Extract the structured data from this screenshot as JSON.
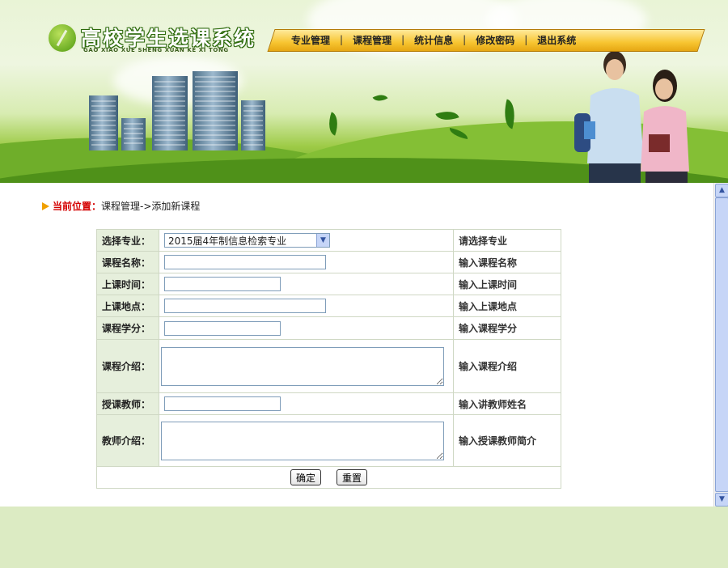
{
  "header": {
    "title": "高校学生选课系统",
    "subtitle": "GAO XIAO XUE SHENG XUAN KE XI TONG",
    "nav": [
      {
        "label": "专业管理"
      },
      {
        "label": "课程管理"
      },
      {
        "label": "统计信息"
      },
      {
        "label": "修改密码"
      },
      {
        "label": "退出系统"
      }
    ],
    "separator": "|"
  },
  "breadcrumb": {
    "label": "当前位置：",
    "path": "课程管理->添加新课程"
  },
  "form": {
    "major": {
      "label": "选择专业：",
      "value": "2015届4年制信息检索专业",
      "hint": "请选择专业"
    },
    "course_name": {
      "label": "课程名称：",
      "hint": "输入课程名称"
    },
    "class_time": {
      "label": "上课时间：",
      "hint": "输入上课时间"
    },
    "class_place": {
      "label": "上课地点：",
      "hint": "输入上课地点"
    },
    "credit": {
      "label": "课程学分：",
      "hint": "输入课程学分"
    },
    "intro": {
      "label": "课程介绍：",
      "hint": "输入课程介绍"
    },
    "teacher": {
      "label": "授课教师：",
      "hint": "输入讲教师姓名"
    },
    "teacher_intro": {
      "label": "教师介绍：",
      "hint": "输入授课教师简介"
    },
    "submit_label": "确定",
    "reset_label": "重置"
  },
  "icons": {
    "breadcrumb": "arrow-right-icon",
    "logo": "leaf-icon",
    "scroll_up": "chevron-up-icon",
    "scroll_down": "chevron-down-icon"
  },
  "colors": {
    "accent": "#f7c531",
    "breadcrumb_label": "#d40000",
    "label_bg": "#e6efdc"
  }
}
